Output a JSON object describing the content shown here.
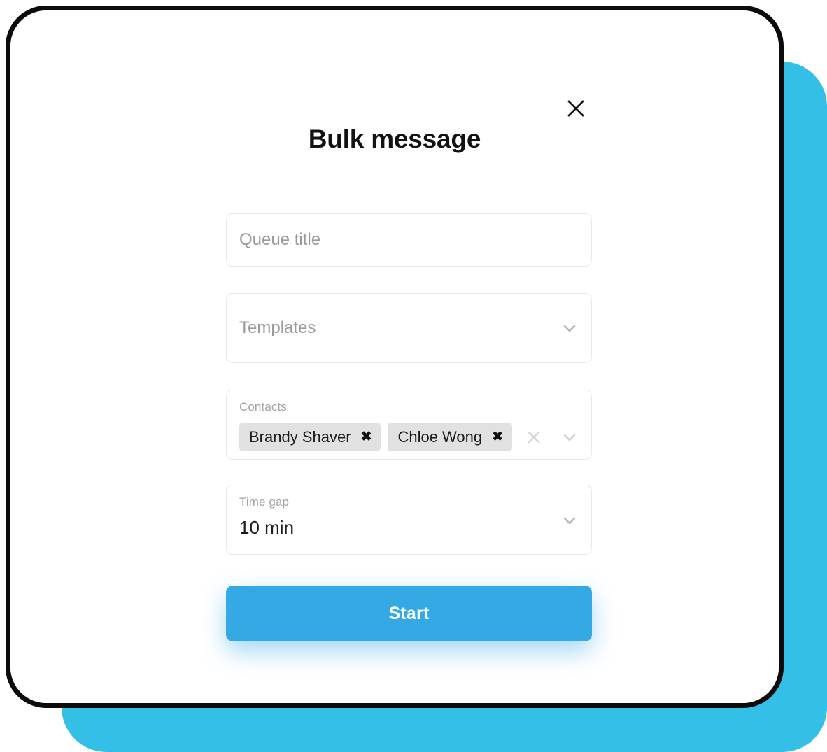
{
  "background": {
    "accent_color": "#33bfe6",
    "frame_border_color": "#0b0b0b",
    "card_color": "#ffffff"
  },
  "dialog": {
    "title": "Bulk message",
    "close_label": "✕"
  },
  "form": {
    "queue_title": {
      "label": "",
      "placeholder": "Queue title",
      "value": ""
    },
    "templates": {
      "placeholder": "Templates",
      "value": "",
      "dropdown_icon": "chevron-down-icon"
    },
    "contacts": {
      "label": "Contacts",
      "chips": [
        {
          "name": "Brandy Shaver",
          "remove_label": "✖"
        },
        {
          "name": "Chloe Wong",
          "remove_label": "✖"
        }
      ],
      "clear_icon": "close-icon",
      "dropdown_icon": "chevron-down-icon"
    },
    "time_gap": {
      "label": "Time gap",
      "value": "10 min",
      "dropdown_icon": "chevron-down-icon"
    },
    "submit": {
      "label": "Start",
      "color": "#35a9e4",
      "text_color": "#ffffff"
    }
  }
}
